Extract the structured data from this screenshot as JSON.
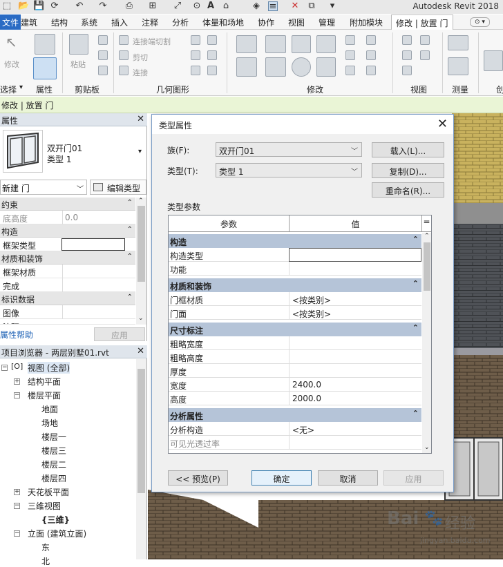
{
  "app": {
    "title": "Autodesk Revit 2018"
  },
  "tabs": [
    {
      "label": "文件"
    },
    {
      "label": "建筑"
    },
    {
      "label": "结构"
    },
    {
      "label": "系统"
    },
    {
      "label": "插入"
    },
    {
      "label": "注释"
    },
    {
      "label": "分析"
    },
    {
      "label": "体量和场地"
    },
    {
      "label": "协作"
    },
    {
      "label": "视图"
    },
    {
      "label": "管理"
    },
    {
      "label": "附加模块"
    },
    {
      "label": "修改 | 放置 门"
    }
  ],
  "ribbon": {
    "modify": "修改",
    "paste": "粘贴",
    "connect_end_cut": "连接端切割",
    "cut": "剪切",
    "join": "连接",
    "panels": {
      "select": "选择",
      "properties": "属性",
      "clipboard": "剪贴板",
      "geometry": "几何图形",
      "modify": "修改",
      "view": "视图",
      "measure": "测量",
      "create": "创"
    }
  },
  "context_bar": {
    "text": "修改 | 放置 门"
  },
  "properties": {
    "title": "属性",
    "type_name": "双开门01",
    "type_sub": "类型 1",
    "new_instance": "新建 门",
    "edit_type": "编辑类型",
    "groups": {
      "constraints": "约束",
      "sill_height": "底高度",
      "sill_value": "0.0",
      "construction": "构造",
      "frame_type": "框架类型",
      "materials": "材质和装饰",
      "frame_material": "框架材质",
      "finish": "完成",
      "identity": "标识数据",
      "image": "图像",
      "comments": "注释"
    },
    "help": "属性帮助",
    "apply": "应用"
  },
  "browser": {
    "title": "项目浏览器 - 两层别墅01.rvt",
    "items": {
      "views": "视图 (全部)",
      "structural_plans": "结构平面",
      "floor_plans": "楼层平面",
      "ground": "地面",
      "site": "场地",
      "level1": "楼层一",
      "level3": "楼层三",
      "level2": "楼层二",
      "level4": "楼层四",
      "ceiling": "天花板平面",
      "view3d": "三维视图",
      "view3d_default": "{三维}",
      "elevations": "立面 (建筑立面)",
      "east": "东",
      "north": "北"
    }
  },
  "dialog": {
    "title": "类型属性",
    "family_label": "族(F):",
    "family_value": "双开门01",
    "type_label": "类型(T):",
    "type_value": "类型 1",
    "load": "载入(L)...",
    "duplicate": "复制(D)...",
    "rename": "重命名(R)...",
    "type_params": "类型参数",
    "col_param": "参数",
    "col_value": "值",
    "groups": {
      "construction": "构造",
      "materials": "材质和装饰",
      "dimensions": "尺寸标注",
      "analysis": "分析属性"
    },
    "rows": {
      "construction_type": "构造类型",
      "function": "功能",
      "frame_material": "门框材质",
      "frame_material_value": "<按类别>",
      "door_panel": "门面",
      "door_panel_value": "<按类别>",
      "rough_width": "粗略宽度",
      "rough_height": "粗略高度",
      "thickness": "厚度",
      "width": "宽度",
      "width_value": "2400.0",
      "height": "高度",
      "height_value": "2000.0",
      "analytic_construction": "分析构造",
      "analytic_value": "<无>",
      "visible_transmittance": "可见光透过率"
    },
    "preview": "<< 预览(P)",
    "ok": "确定",
    "cancel": "取消",
    "apply": "应用"
  },
  "watermark": {
    "brand": "Bai",
    "brand2": "经验",
    "url": "jingyan.baidu.com"
  }
}
